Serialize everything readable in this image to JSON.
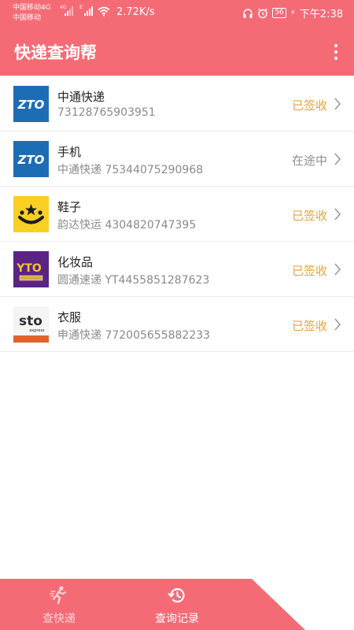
{
  "status_bar": {
    "carrier_1": "中国移动4G",
    "carrier_2": "中国移动",
    "sim1_tag": "4G",
    "sim2_tag": "E",
    "net_speed": "2.72K/s",
    "battery": "56",
    "time": "下午2:38"
  },
  "app_bar": {
    "title": "快递查询帮",
    "menu_icon": "more-vert-icon"
  },
  "colors": {
    "primary": "#f46b76",
    "signed": "#e8a33d",
    "in_transit": "#8f8f8f"
  },
  "list": [
    {
      "name": "中通快递",
      "subtitle": "73128765903951",
      "status": "已签收",
      "status_type": "done",
      "logo": "zto-logo"
    },
    {
      "name": "手机",
      "subtitle": "中通快递 75344075290968",
      "status": "在途中",
      "status_type": "transit",
      "logo": "zto-logo"
    },
    {
      "name": "鞋子",
      "subtitle": "韵达快运 4304820747395",
      "status": "已签收",
      "status_type": "done",
      "logo": "yunda-logo"
    },
    {
      "name": "化妆品",
      "subtitle": "圆通速递 YT4455851287623",
      "status": "已签收",
      "status_type": "done",
      "logo": "yto-logo"
    },
    {
      "name": "衣服",
      "subtitle": "申通快递 772005655882233",
      "status": "已签收",
      "status_type": "done",
      "logo": "sto-logo"
    }
  ],
  "logo_text": {
    "zto": "ZTO",
    "yto": "YTO",
    "sto": "sto",
    "sto_sub": "express"
  },
  "bottom_nav": {
    "query_label": "查快递",
    "history_label": "查询记录",
    "active": "history"
  }
}
